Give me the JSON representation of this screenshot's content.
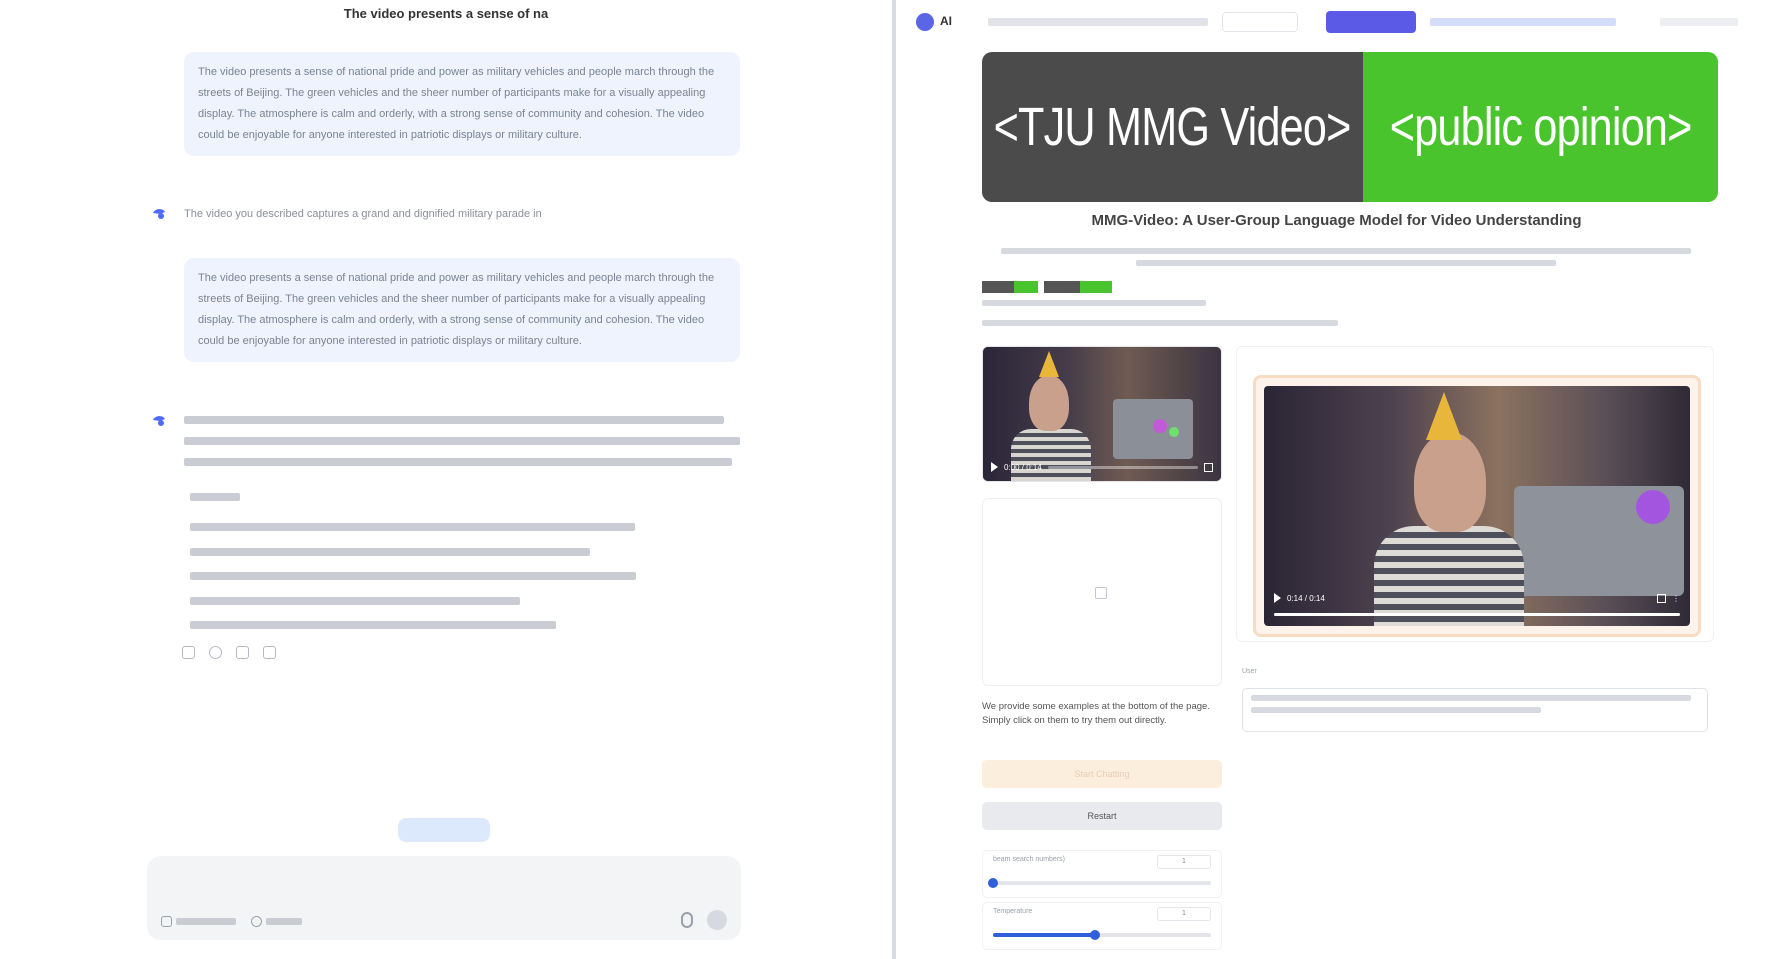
{
  "chat": {
    "title": "The video presents a sense of na",
    "user_message_1": "The video presents a sense of national pride and power as military vehicles and people march through the streets of Beijing. The green vehicles and the sheer number of participants make for a visually appealing display. The atmosphere is calm and orderly, with a strong sense of community and cohesion. The video could be enjoyable for anyone interested in patriotic displays or military culture.",
    "bot_reply_1": "The video you described captures a grand and dignified military parade in",
    "user_message_2": "The video presents a sense of national pride and power as military vehicles and people march through the streets of Beijing. The green vehicles and the sheer number of participants make for a visually appealing display. The atmosphere is calm and orderly, with a strong sense of community and cohesion. The video could be enjoyable for anyone interested in patriotic displays or military culture.",
    "new_chat_label": "",
    "input_placeholder": "",
    "footer_note": ""
  },
  "browser": {
    "logo_label": "AI",
    "search_label": "",
    "banner_left": "<TJU MMG Video>",
    "banner_right": "<public opinion>",
    "app_title": "MMG-Video: A User-Group Language Model for Video Understanding",
    "hint": "We provide some examples at the bottom of the page. Simply click on them to try them out directly.",
    "start_button": "Start Chatting",
    "restart_button": "Restart",
    "slider_1_label": "beam search numbers)",
    "slider_1_value": "1",
    "slider_2_label": "Temperature",
    "slider_2_value": "1",
    "video_time": "0:00 / 0:14",
    "chat_video_time": "0:14 / 0:14",
    "user_label": "User"
  },
  "colors": {
    "banner_dark": "#4b4b4b",
    "banner_green": "#4ac42c",
    "accent_purple": "#5a5ae6",
    "slider_blue": "#2f5fd9"
  },
  "levels": {
    "slider_1_fraction": 0.0,
    "slider_2_fraction": 0.47,
    "video_progress_fraction": 0.0,
    "chat_video_progress_fraction": 1.0
  }
}
